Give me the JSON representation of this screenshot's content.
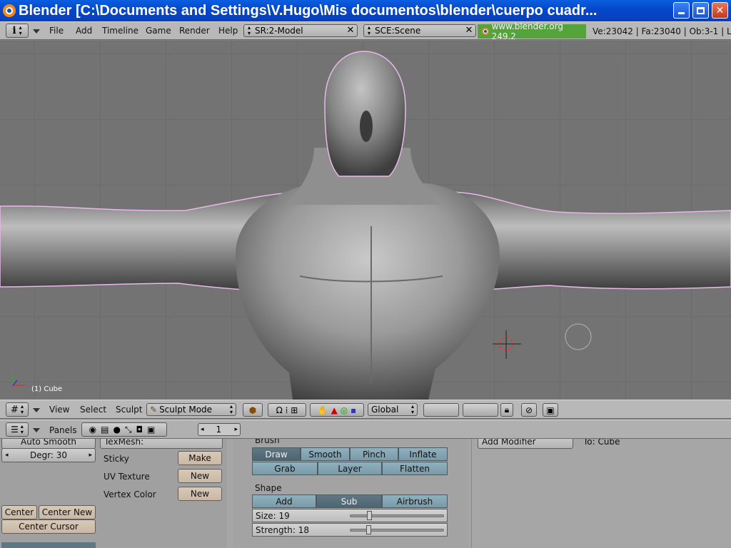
{
  "window": {
    "title": "Blender [C:\\Documents and Settings\\V.Hugo\\Mis documentos\\blender\\cuerpo cuadr..."
  },
  "top_header": {
    "menus": [
      "File",
      "Add",
      "Timeline",
      "Game",
      "Render",
      "Help"
    ],
    "screen_field": "SR:2-Model",
    "scene_field": "SCE:Scene",
    "site_version": "www.blender.org 249.2",
    "stats": "Ve:23042 | Fa:23040 | Ob:3-1 | L"
  },
  "viewport": {
    "object_label": "(1) Cube"
  },
  "viewport_header": {
    "menus": [
      "View",
      "Select",
      "Sculpt"
    ],
    "mode": "Sculpt Mode",
    "orientation": "Global"
  },
  "buttons_header": {
    "panels_label": "Panels",
    "frame": "1"
  },
  "mesh_panel": {
    "auto_smooth": "Auto Smooth",
    "degr": "Degr: 30",
    "texmesh": "TexMesh:",
    "sticky_label": "Sticky",
    "sticky_btn": "Make",
    "uv_label": "UV Texture",
    "uv_btn": "New",
    "vc_label": "Vertex Color",
    "vc_btn": "New",
    "center": "Center",
    "center_new": "Center New",
    "center_cursor": "Center Cursor"
  },
  "brush_panel": {
    "brush_label": "Brush",
    "brushes_row1": [
      "Draw",
      "Smooth",
      "Pinch",
      "Inflate"
    ],
    "brushes_row2": [
      "Grab",
      "Layer",
      "Flatten"
    ],
    "active_brush": "Draw",
    "shape_label": "Shape",
    "shapes": [
      "Add",
      "Sub",
      "Airbrush"
    ],
    "active_shape": "Sub",
    "size_label": "Size: 19",
    "size_fraction": 0.19,
    "strength_label": "Strength: 18",
    "strength_fraction": 0.18
  },
  "modifiers_panel": {
    "add_modifier": "Add Modifier",
    "to_label": "To: Cube"
  }
}
